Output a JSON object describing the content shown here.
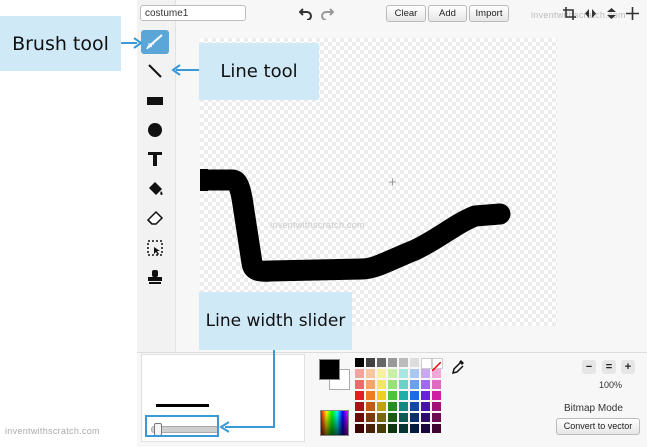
{
  "costume_name": "costume1",
  "toolbar": {
    "clear_label": "Clear",
    "add_label": "Add",
    "import_label": "Import"
  },
  "tools": [
    {
      "name": "brush-tool",
      "icon": "brush-icon",
      "active": true
    },
    {
      "name": "line-tool",
      "icon": "line-icon",
      "active": false
    },
    {
      "name": "rectangle-tool",
      "icon": "rectangle-icon",
      "active": false
    },
    {
      "name": "ellipse-tool",
      "icon": "ellipse-icon",
      "active": false
    },
    {
      "name": "text-tool",
      "icon": "text-icon",
      "active": false
    },
    {
      "name": "fill-tool",
      "icon": "bucket-icon",
      "active": false
    },
    {
      "name": "eraser-tool",
      "icon": "eraser-icon",
      "active": false
    },
    {
      "name": "select-tool",
      "icon": "select-icon",
      "active": false
    },
    {
      "name": "stamp-tool",
      "icon": "stamp-icon",
      "active": false
    }
  ],
  "callouts": {
    "brush": "Brush tool",
    "line": "Line tool",
    "slider": "Line width slider"
  },
  "watermarks": {
    "top_right": "inventwithscratch.com",
    "canvas": "inventwithscratch.com",
    "bottom_left": "inventwithscratch.com"
  },
  "zoom": {
    "level": "100%"
  },
  "mode": {
    "label": "Bitmap Mode",
    "convert_label": "Convert to vector"
  },
  "colors": {
    "selected_primary": "#000000",
    "selected_secondary": "#ffffff",
    "tool_active": "#5aa6d6",
    "callout_bg": "#cfe9f7",
    "callout_line": "#3a9ad9"
  },
  "line_width": {
    "value_fraction": 0.08
  }
}
